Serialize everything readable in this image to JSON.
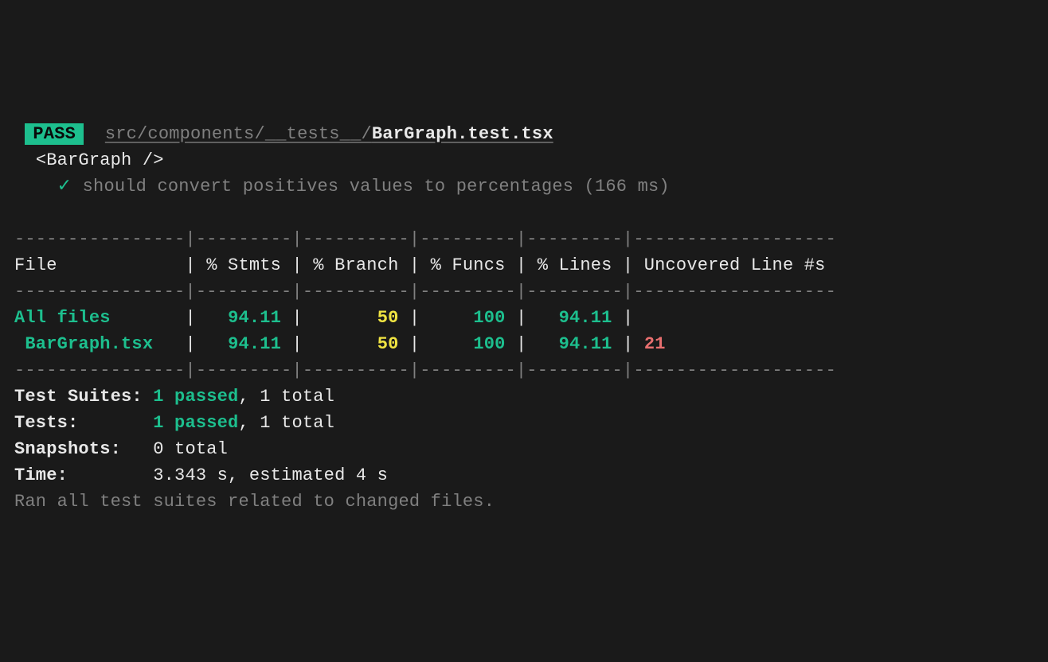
{
  "badge": "PASS",
  "path_dir": "src/components/__tests__/",
  "path_file": "BarGraph.test.tsx",
  "describe": "<BarGraph />",
  "check": "✓",
  "test_name": "should convert positives values to percentages (166 ms)",
  "table": {
    "rule_top": "----------------|---------|----------|---------|---------|-------------------",
    "header": "File            | % Stmts | % Branch | % Funcs | % Lines | Uncovered Line #s ",
    "rule_mid": "----------------|---------|----------|---------|---------|-------------------",
    "row_all": {
      "label": "All files      ",
      "sep1": " |   ",
      "stmts": "94.11",
      "sep2": " |       ",
      "branch": "50",
      "sep3": " |     ",
      "funcs": "100",
      "sep4": " |   ",
      "lines": "94.11",
      "sep5": " | ",
      "uncov": "                  "
    },
    "row_file": {
      "label": " BarGraph.tsx  ",
      "sep1": " |   ",
      "stmts": "94.11",
      "sep2": " |       ",
      "branch": "50",
      "sep3": " |     ",
      "funcs": "100",
      "sep4": " |   ",
      "lines": "94.11",
      "sep5": " | ",
      "uncov": "21",
      "uncov_pad": "                "
    },
    "rule_bot": "----------------|---------|----------|---------|---------|-------------------"
  },
  "summary": {
    "suites_label": "Test Suites: ",
    "suites_passed": "1 passed",
    "suites_rest": ", 1 total",
    "tests_label": "Tests:       ",
    "tests_passed": "1 passed",
    "tests_rest": ", 1 total",
    "snapshots_label": "Snapshots:   ",
    "snapshots_rest": "0 total",
    "time_label": "Time:        ",
    "time_rest": "3.343 s, estimated 4 s",
    "footer": "Ran all test suites related to changed files."
  }
}
